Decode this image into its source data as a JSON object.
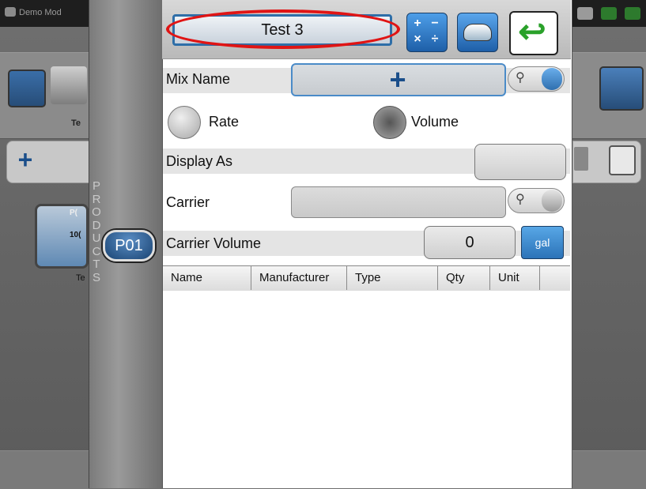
{
  "background": {
    "demo_label": "Demo Mod",
    "te_label": "Te",
    "tile_text_top": "P(",
    "tile_text_mid": "10(",
    "te_label_2": "Te"
  },
  "sidebar": {
    "products_letters": [
      "P",
      "R",
      "O",
      "D",
      "U",
      "C",
      "T",
      "S"
    ],
    "p01_label": "P01"
  },
  "header": {
    "title": "Test 3"
  },
  "form": {
    "mix_name_label": "Mix Name",
    "rate_label": "Rate",
    "volume_label": "Volume",
    "selected_mode": "Volume",
    "display_as_label": "Display As",
    "display_as_value": "",
    "carrier_label": "Carrier",
    "carrier_value": "",
    "carrier_volume_label": "Carrier Volume",
    "carrier_volume_value": "0",
    "carrier_volume_unit": "gal"
  },
  "table": {
    "columns": [
      "Name",
      "Manufacturer",
      "Type",
      "Qty",
      "Unit"
    ],
    "rows": []
  },
  "colors": {
    "accent_blue": "#2e6ea8",
    "highlight_red": "#e01414",
    "back_green": "#2aa12a"
  }
}
